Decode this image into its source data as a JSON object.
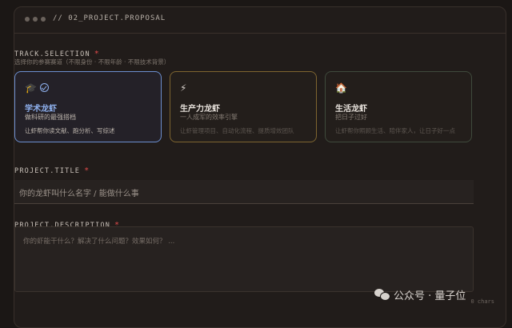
{
  "window": {
    "title": "// 02_PROJECT.PROPOSAL"
  },
  "track": {
    "label": "TRACK.SELECTION",
    "required_mark": "*",
    "hint": "选择你的参赛赛道（不限身份 · 不限年龄 · 不限技术背景）",
    "options": [
      {
        "icon": "🎓",
        "name": "学术龙虾",
        "subtitle": "做科研的最强搭档",
        "description": "让虾帮你读文献、跑分析、写综述",
        "selected": true
      },
      {
        "icon": "⚡",
        "name": "生产力龙虾",
        "subtitle": "一人成军的效率引擎",
        "description": "让虾管理项目、自动化流程、提质增效团队",
        "selected": false
      },
      {
        "icon": "🏠",
        "name": "生活龙虾",
        "subtitle": "把日子过好",
        "description": "让虾帮你照顾生活、陪伴家人，让日子好一点",
        "selected": false
      }
    ]
  },
  "project_title": {
    "label": "PROJECT.TITLE",
    "required_mark": "*",
    "placeholder": "你的龙虾叫什么名字 / 能做什么事"
  },
  "project_description": {
    "label": "PROJECT.DESCRIPTION",
    "required_mark": "*",
    "placeholder": "你的虾能干什么？解决了什么问题？效果如何？ ...",
    "char_count": "0 chars"
  },
  "watermark": {
    "text": "公众号 · 量子位"
  },
  "colors": {
    "selected_border": "#6c8fd0",
    "required": "#e24b4b",
    "selected_text": "#8fb1ee"
  }
}
